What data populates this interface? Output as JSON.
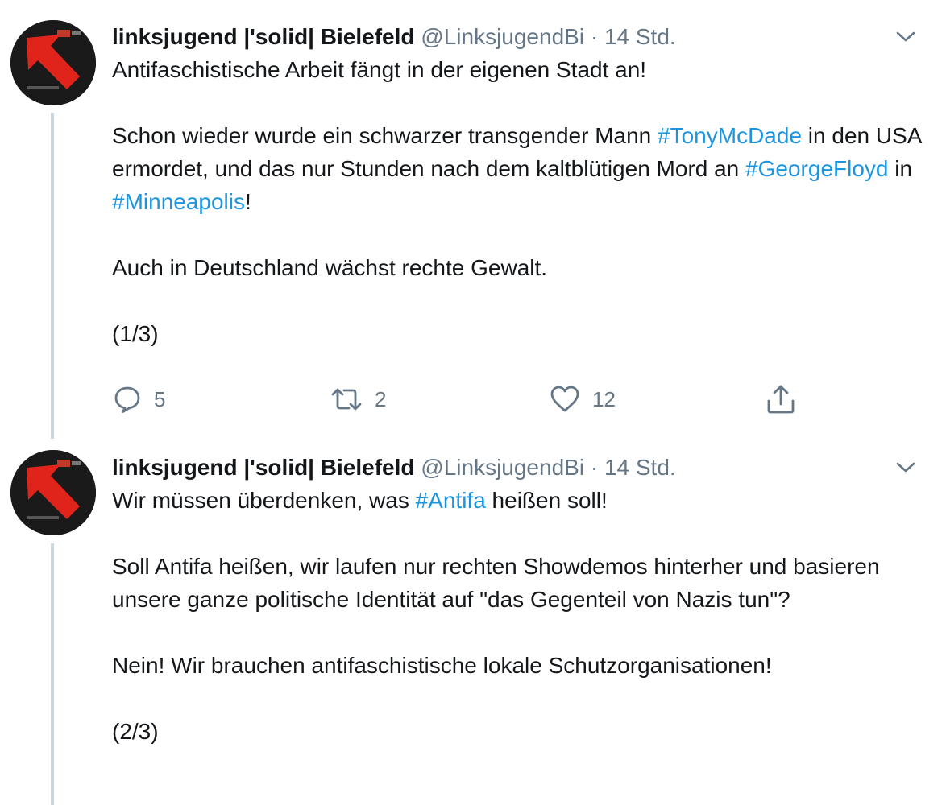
{
  "tweets": [
    {
      "display_name": "linksjugend |'solid| Bielefeld",
      "handle": "@LinksjugendBi",
      "separator": "·",
      "time": "14 Std.",
      "paragraphs": [
        [
          {
            "text": "Antifaschistische Arbeit fängt in der eigenen Stadt an!"
          }
        ],
        [
          {
            "text": "Schon wieder wurde ein schwarzer transgender Mann "
          },
          {
            "text": "#TonyMcDade",
            "hashtag": true
          },
          {
            "text": " in den USA ermordet, und das nur Stunden nach dem kaltblütigen Mord an "
          },
          {
            "text": "#GeorgeFloyd",
            "hashtag": true
          },
          {
            "text": " in "
          },
          {
            "text": "#Minneapolis",
            "hashtag": true
          },
          {
            "text": "!"
          }
        ],
        [
          {
            "text": "Auch in Deutschland wächst rechte Gewalt."
          }
        ],
        [
          {
            "text": "(1/3)"
          }
        ]
      ],
      "actions": {
        "reply_count": "5",
        "retweet_count": "2",
        "like_count": "12"
      }
    },
    {
      "display_name": "linksjugend |'solid| Bielefeld",
      "handle": "@LinksjugendBi",
      "separator": "·",
      "time": "14 Std.",
      "paragraphs": [
        [
          {
            "text": "Wir müssen überdenken, was "
          },
          {
            "text": "#Antifa",
            "hashtag": true
          },
          {
            "text": " heißen soll!"
          }
        ],
        [
          {
            "text": "Soll Antifa heißen, wir laufen nur rechten Showdemos hinterher und basieren unsere ganze politische Identität auf \"das Gegenteil von Nazis tun\"?"
          }
        ],
        [
          {
            "text": "Nein! Wir brauchen antifaschistische lokale Schutzorganisationen!"
          }
        ],
        [
          {
            "text": "(2/3)"
          }
        ]
      ]
    }
  ],
  "icons": {
    "reply": "reply-icon",
    "retweet": "retweet-icon",
    "like": "like-icon",
    "share": "share-icon",
    "caret": "chevron-down-icon",
    "avatar": "red-arrow-logo"
  },
  "colors": {
    "text": "#14171a",
    "secondary": "#657786",
    "hashtag": "#1b95e0",
    "thread_line": "#ccd6dd",
    "avatar_arrow": "#e0241b"
  }
}
